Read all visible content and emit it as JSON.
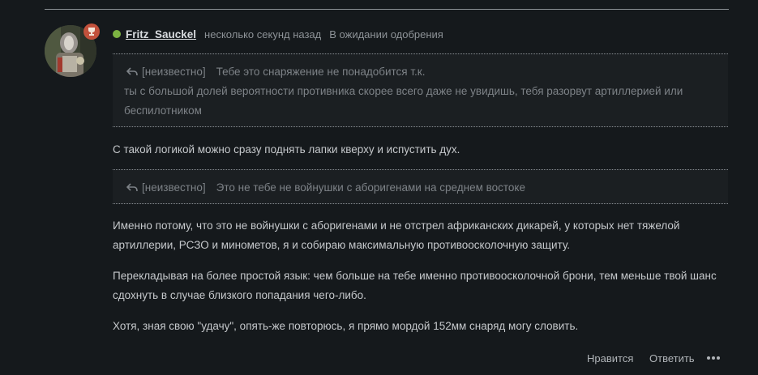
{
  "comment": {
    "author": "Fritz_Sauckel",
    "time": "несколько секунд назад",
    "status": "В ожидании одобрения",
    "online_color": "#7cb342",
    "badge_color": "#c2513c",
    "avatar_icon": "user-avatar",
    "badge_icon": "trophy-icon",
    "quotes": [
      {
        "icon": "reply-arrow-icon",
        "author": "[неизвестно]",
        "first_line": "Тебе это снаряжение не понадобится т.к.",
        "continuation": "ты с большой долей вероятности противника скорее всего даже не увидишь, тебя разорвут артиллерией или беспилотником"
      },
      {
        "icon": "reply-arrow-icon",
        "author": "[неизвестно]",
        "first_line": "Это не тебе не войнушки с аборигенами на среднем востоке",
        "continuation": ""
      }
    ],
    "paragraphs": [
      "С такой логикой можно сразу поднять лапки кверху и испустить дух.",
      "Именно потому, что это не войнушки с аборигенами и не отстрел африканских дикарей, у которых нет тяжелой артиллерии, РСЗО и минометов, я и собираю максимальную противоосколочную защиту.",
      "Перекладывая на более простой язык: чем больше на тебе именно противоосколочной брони, тем меньше твой шанс сдохнуть в случае близкого попадания чего-либо.",
      "Хотя, зная свою \"удачу\", опять-же повторюсь, я прямо мордой 152мм снаряд могу словить."
    ],
    "actions": {
      "like": "Нравится",
      "reply": "Ответить",
      "more_icon": "more-dots-icon"
    }
  }
}
